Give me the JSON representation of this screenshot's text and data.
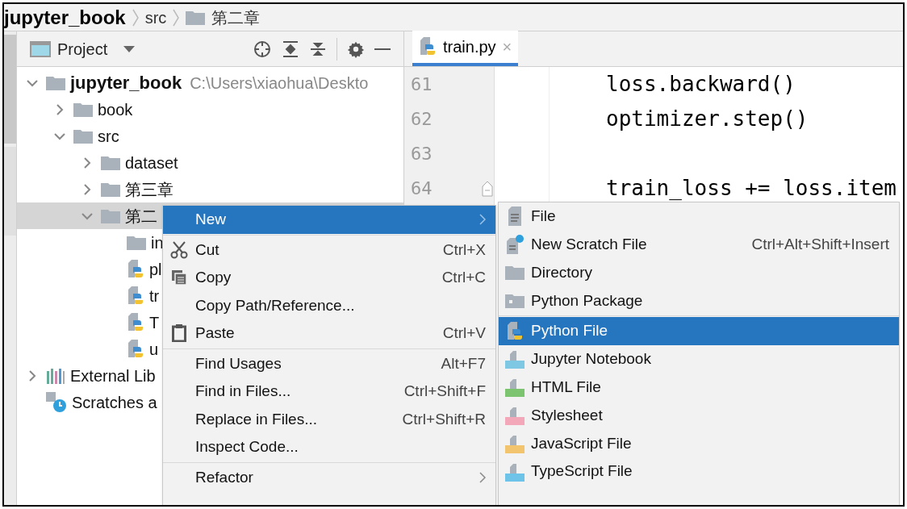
{
  "breadcrumb": [
    {
      "label": "jupyter_book",
      "kind": "project"
    },
    {
      "label": "src",
      "kind": "plain"
    },
    {
      "label": "第二章",
      "kind": "folder"
    }
  ],
  "project_panel": {
    "title": "Project",
    "tree": [
      {
        "label": "jupyter_book",
        "path": "C:\\Users\\xiaohua\\Deskto",
        "kind": "folder",
        "expanded": true,
        "selected": false,
        "children": [
          {
            "label": "book",
            "kind": "folder",
            "expanded": false,
            "selected": false
          },
          {
            "label": "src",
            "kind": "folder",
            "expanded": true,
            "selected": false,
            "children": [
              {
                "label": "dataset",
                "kind": "folder",
                "expanded": false,
                "selected": false
              },
              {
                "label": "第三章",
                "kind": "folder",
                "expanded": false,
                "selected": false
              },
              {
                "label": "第二",
                "kind": "folder",
                "expanded": true,
                "selected": true,
                "children": [
                  {
                    "label": "in",
                    "kind": "folder",
                    "selected": false
                  },
                  {
                    "label": "pl",
                    "kind": "python",
                    "selected": false
                  },
                  {
                    "label": "tr",
                    "kind": "python",
                    "selected": false
                  },
                  {
                    "label": "T",
                    "kind": "python",
                    "selected": false
                  },
                  {
                    "label": "u",
                    "kind": "python",
                    "selected": false
                  }
                ]
              }
            ]
          }
        ]
      },
      {
        "label": "External Lib",
        "kind": "libraries",
        "expanded": false,
        "selected": false
      },
      {
        "label": "Scratches a",
        "kind": "scratches",
        "selected": false
      }
    ]
  },
  "editor": {
    "tabs": [
      {
        "label": "train.py",
        "close": "×",
        "selected": true
      }
    ],
    "lines": [
      {
        "number": "61",
        "code": "loss.backward()"
      },
      {
        "number": "62",
        "code": "optimizer.step()"
      },
      {
        "number": "63"
      },
      {
        "number": "64",
        "code": "train_loss += loss.item",
        "fold": true
      }
    ]
  },
  "context_menu": {
    "groups": [
      [
        {
          "label": "New",
          "kind": "plain",
          "selected": true,
          "submenu": true
        }
      ],
      [
        {
          "label": "Cut",
          "kind": "cut",
          "shortcut": "Ctrl+X",
          "selected": false,
          "submenu": false
        },
        {
          "label": "Copy",
          "kind": "copy",
          "shortcut": "Ctrl+C",
          "selected": false,
          "submenu": false
        },
        {
          "label": "Copy Path/Reference...",
          "kind": "plain",
          "selected": false,
          "submenu": false
        },
        {
          "label": "Paste",
          "kind": "paste",
          "shortcut": "Ctrl+V",
          "selected": false,
          "submenu": false
        }
      ],
      [
        {
          "label": "Find Usages",
          "kind": "plain",
          "shortcut": "Alt+F7",
          "selected": false,
          "submenu": false
        },
        {
          "label": "Find in Files...",
          "kind": "plain",
          "shortcut": "Ctrl+Shift+F",
          "selected": false,
          "submenu": false
        },
        {
          "label": "Replace in Files...",
          "kind": "plain",
          "shortcut": "Ctrl+Shift+R",
          "selected": false,
          "submenu": false
        },
        {
          "label": "Inspect Code...",
          "kind": "plain",
          "selected": false,
          "submenu": false
        }
      ],
      [
        {
          "label": "Refactor",
          "kind": "plain",
          "selected": false,
          "submenu": true
        }
      ]
    ]
  },
  "new_submenu": {
    "groups": [
      [
        {
          "label": "File",
          "kind": "file",
          "selected": false
        },
        {
          "label": "New Scratch File",
          "kind": "scratch",
          "shortcut": "Ctrl+Alt+Shift+Insert",
          "selected": false
        },
        {
          "label": "Directory",
          "kind": "directory",
          "selected": false
        },
        {
          "label": "Python Package",
          "kind": "package",
          "selected": false
        }
      ],
      [
        {
          "label": "Python File",
          "kind": "python",
          "selected": true
        },
        {
          "label": "Jupyter Notebook",
          "kind": "jupyter",
          "selected": false
        },
        {
          "label": "HTML File",
          "kind": "html",
          "selected": false
        },
        {
          "label": "Stylesheet",
          "kind": "css",
          "selected": false
        },
        {
          "label": "JavaScript File",
          "kind": "js",
          "selected": false
        },
        {
          "label": "TypeScript File",
          "kind": "ts",
          "selected": false
        }
      ]
    ]
  }
}
